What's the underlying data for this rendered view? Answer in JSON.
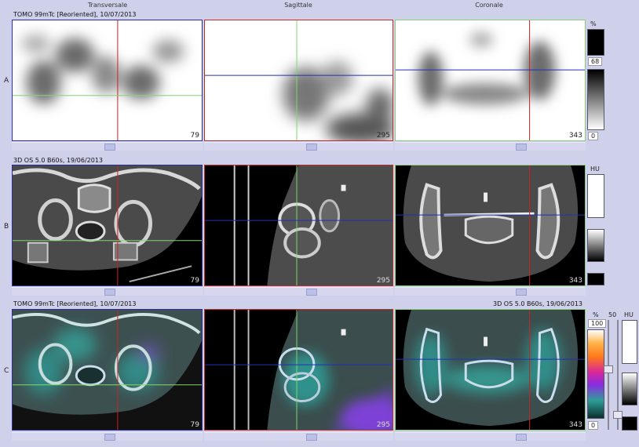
{
  "headers": {
    "transverse": "Transversale",
    "sagittal": "Sagittale",
    "coronal": "Coronale"
  },
  "rows": {
    "a": {
      "letter": "A",
      "title": "TOMO 99mTc [Reoriented], 10/07/2013"
    },
    "b": {
      "letter": "B",
      "title": "3D  OS  5.0  B60s, 19/06/2013"
    },
    "c": {
      "letter": "C",
      "title_left": "TOMO 99mTc [Reoriented], 10/07/2013",
      "title_right": "3D  OS  5.0  B60s, 19/06/2013"
    }
  },
  "slice_numbers": {
    "transverse": "79",
    "sagittal": "295",
    "coronal": "343"
  },
  "colorbars": {
    "a": {
      "unit": "%",
      "top_value": "68",
      "bottom_value": "0"
    },
    "b": {
      "unit": "HU"
    },
    "c": {
      "unit_pct": "%",
      "top_value": "100",
      "bottom_value": "0",
      "slider_value": "50",
      "unit_hu": "HU"
    }
  },
  "colors": {
    "transverse_border": "#2a2d9a",
    "sagittal_border": "#c32c2c",
    "coronal_border": "#8ad07a",
    "crosshair_red": "#cc2222",
    "crosshair_green": "#7fd86a",
    "crosshair_blue": "#2030b8"
  }
}
